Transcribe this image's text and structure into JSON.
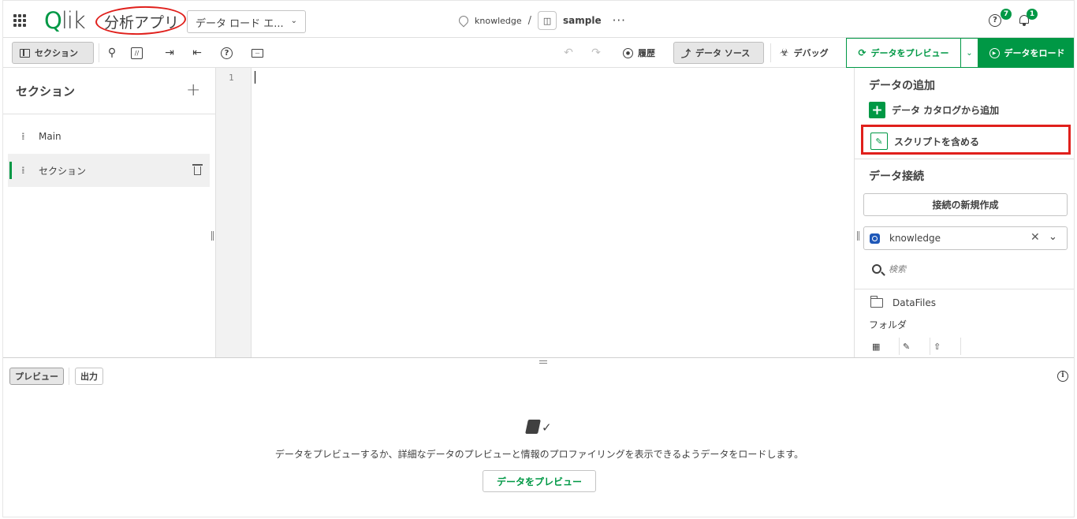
{
  "header": {
    "logo_q": "Q",
    "logo_rest": "lik",
    "app_name": "分析アプリ",
    "mode_select": "データ ロード エ...",
    "space": "knowledge",
    "separator": "/",
    "app_title": "sample",
    "more": "···",
    "help_badge": "7",
    "notifications_badge": "1"
  },
  "toolbar": {
    "sections_label": "セクション",
    "history_label": "履歴",
    "datasource_label": "データ ソース",
    "debug_label": "デバッグ",
    "preview_label": "データをプレビュー",
    "load_label": "データをロード"
  },
  "sections": {
    "title": "セクション",
    "add": "+",
    "items": [
      {
        "label": "Main",
        "selected": false
      },
      {
        "label": "セクション",
        "selected": true
      }
    ]
  },
  "editor": {
    "line_numbers": [
      "1"
    ]
  },
  "right_panel": {
    "add_data_title": "データの追加",
    "add_from_catalog": "データ カタログから追加",
    "include_script": "スクリプトを含める",
    "connections_title": "データ接続",
    "new_connection": "接続の新規作成",
    "connection_value": "knowledge",
    "search_placeholder": "検索",
    "folder_name": "DataFiles",
    "folder_type": "フォルダ"
  },
  "bottom": {
    "tab_preview": "プレビュー",
    "tab_output": "出力",
    "empty_message": "データをプレビューするか、詳細なデータのプレビューと情報のプロファイリングを表示できるようデータをロードします。",
    "empty_button": "データをプレビュー"
  },
  "colors": {
    "accent": "#009845",
    "annotation": "#e0201c"
  }
}
